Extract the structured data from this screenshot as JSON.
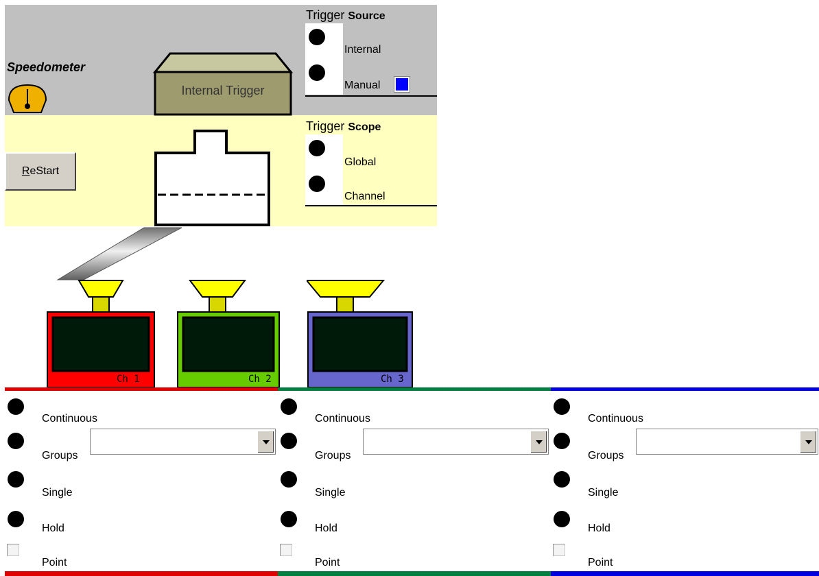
{
  "trigger_source": {
    "title_prefix": "Trigger",
    "title_bold": "Source",
    "options": [
      "Internal",
      "Manual"
    ]
  },
  "trigger_scope": {
    "title_prefix": "Trigger",
    "title_bold": "Scope",
    "options": [
      "Global",
      "Channel"
    ]
  },
  "speedometer": {
    "label": "Speedometer"
  },
  "trigger_box": {
    "label": "Internal Trigger"
  },
  "restart": {
    "label_mnemonic": "R",
    "label_rest": "eStart"
  },
  "channels": [
    {
      "label": "Ch 1",
      "color": "#ff0000",
      "line_color": "#e00000"
    },
    {
      "label": "Ch 2",
      "color": "#66cc00",
      "line_color": "#008040"
    },
    {
      "label": "Ch 3",
      "color": "#6666cc",
      "line_color": "#0000e0"
    }
  ],
  "channel_modes": [
    {
      "continuous": "Continuous",
      "groups": "Groups",
      "groups_value": "",
      "single": "Single",
      "hold": "Hold",
      "point": "Point"
    },
    {
      "continuous": "Continuous",
      "groups": "Groups",
      "groups_value": "",
      "single": "Single",
      "hold": "Hold",
      "point": "Point"
    },
    {
      "continuous": "Continuous",
      "groups": "Groups",
      "groups_value": "",
      "single": "Single",
      "hold": "Hold",
      "point": "Point"
    }
  ],
  "colors": {
    "top_band": "#c0c0c0",
    "scope_band": "#ffffc0",
    "manual_indicator": "#0000ff",
    "trigger_box": "#9e9c6e",
    "funnel": "#ffff00"
  }
}
